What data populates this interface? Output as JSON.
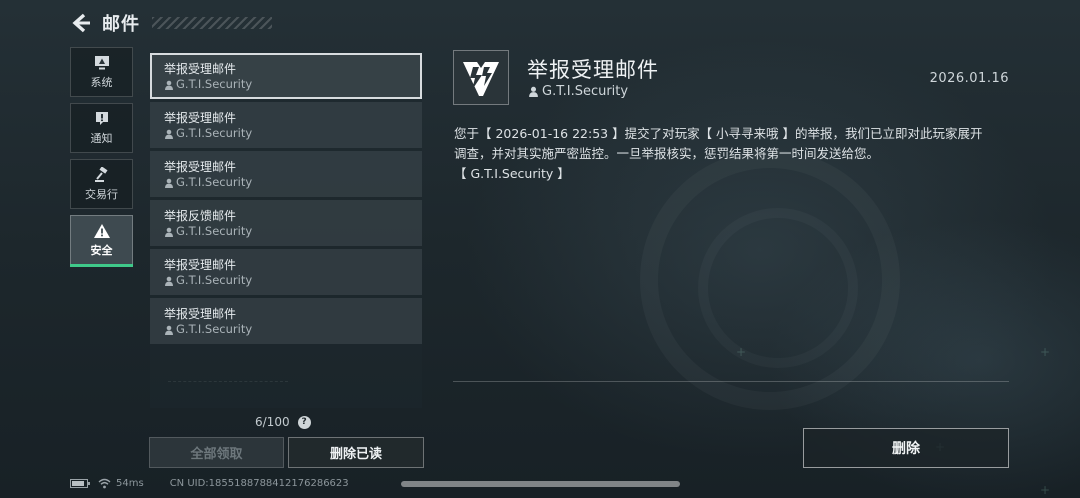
{
  "header": {
    "title": "邮件"
  },
  "sidebar": {
    "tabs": [
      {
        "label": "系统",
        "icon": "monitor-icon",
        "active": false
      },
      {
        "label": "通知",
        "icon": "exclamation-icon",
        "active": false
      },
      {
        "label": "交易行",
        "icon": "gavel-icon",
        "active": false
      },
      {
        "label": "安全",
        "icon": "warning-icon",
        "active": true
      }
    ]
  },
  "mail_list": {
    "items": [
      {
        "title": "举报受理邮件",
        "sender": "G.T.I.Security",
        "selected": true
      },
      {
        "title": "举报受理邮件",
        "sender": "G.T.I.Security",
        "selected": false
      },
      {
        "title": "举报受理邮件",
        "sender": "G.T.I.Security",
        "selected": false
      },
      {
        "title": "举报反馈邮件",
        "sender": "G.T.I.Security",
        "selected": false
      },
      {
        "title": "举报受理邮件",
        "sender": "G.T.I.Security",
        "selected": false
      },
      {
        "title": "举报受理邮件",
        "sender": "G.T.I.Security",
        "selected": false
      }
    ],
    "count": "6/100",
    "help": "?",
    "claim_all_label": "全部领取",
    "delete_read_label": "删除已读"
  },
  "detail": {
    "logo_icon": "gti-logo-icon",
    "title": "举报受理邮件",
    "sender": "G.T.I.Security",
    "date": "2026.01.16",
    "body_lines": [
      "您于【 2026-01-16 22:53 】提交了对玩家【 小寻寻来哦 】的举报，我们已立即对此玩家展开",
      "调查，并对其实施严密监控。一旦举报核实，惩罚结果将第一时间发送给您。",
      "【 G.T.I.Security 】"
    ],
    "delete_label": "删除"
  },
  "status_bar": {
    "ping": "54ms",
    "uid": "CN UID:1855188788412176286623"
  },
  "colors": {
    "active_accent": "#3fc98a"
  }
}
